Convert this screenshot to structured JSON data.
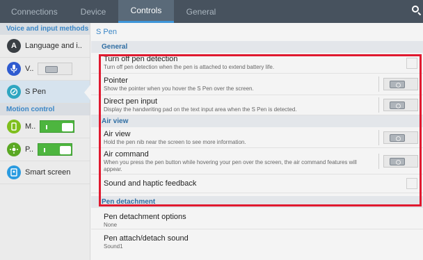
{
  "tabs": [
    {
      "label": "Connections",
      "active": false
    },
    {
      "label": "Device",
      "active": false
    },
    {
      "label": "Controls",
      "active": true
    },
    {
      "label": "General",
      "active": false
    }
  ],
  "sidebar": {
    "voice_header": "Voice and input methods",
    "language_label": "Language and i..",
    "voice_label": "V..",
    "spen_label": "S Pen",
    "motion_header": "Motion control",
    "motion_label": "M..",
    "palm_label": "P..",
    "smart_label": "Smart screen"
  },
  "main": {
    "breadcrumb": "S Pen",
    "general_header": "General",
    "turn_off": {
      "title": "Turn off pen detection",
      "sub": "Turn off pen detection when the pen is attached to extend battery life."
    },
    "pointer": {
      "title": "Pointer",
      "sub": "Show the pointer when you hover the S Pen over the screen."
    },
    "direct_pen": {
      "title": "Direct pen input",
      "sub": "Display the handwriting pad on the text input area when the S Pen is detected."
    },
    "airview_header": "Air view",
    "airview": {
      "title": "Air view",
      "sub": "Hold the pen nib near the screen to see more information."
    },
    "aircommand": {
      "title": "Air command",
      "sub": "When you press the pen button while hovering your pen over the screen, the air command features will appear."
    },
    "sound": {
      "title": "Sound and haptic feedback"
    },
    "detach_header": "Pen detachment",
    "detach_options": {
      "title": "Pen detachment options",
      "sub": "None"
    },
    "attach_sound": {
      "title": "Pen attach/detach sound",
      "sub": "Sound1"
    }
  },
  "colors": {
    "tabbar": "#47525e",
    "accent": "#3e95d8",
    "highlight_box": "#e0192f",
    "toggle_on": "#4db53f"
  },
  "icons": [
    "search-icon",
    "language-icon",
    "microphone-icon",
    "s-pen-icon",
    "motion-icon",
    "palm-icon",
    "smart-screen-icon"
  ]
}
